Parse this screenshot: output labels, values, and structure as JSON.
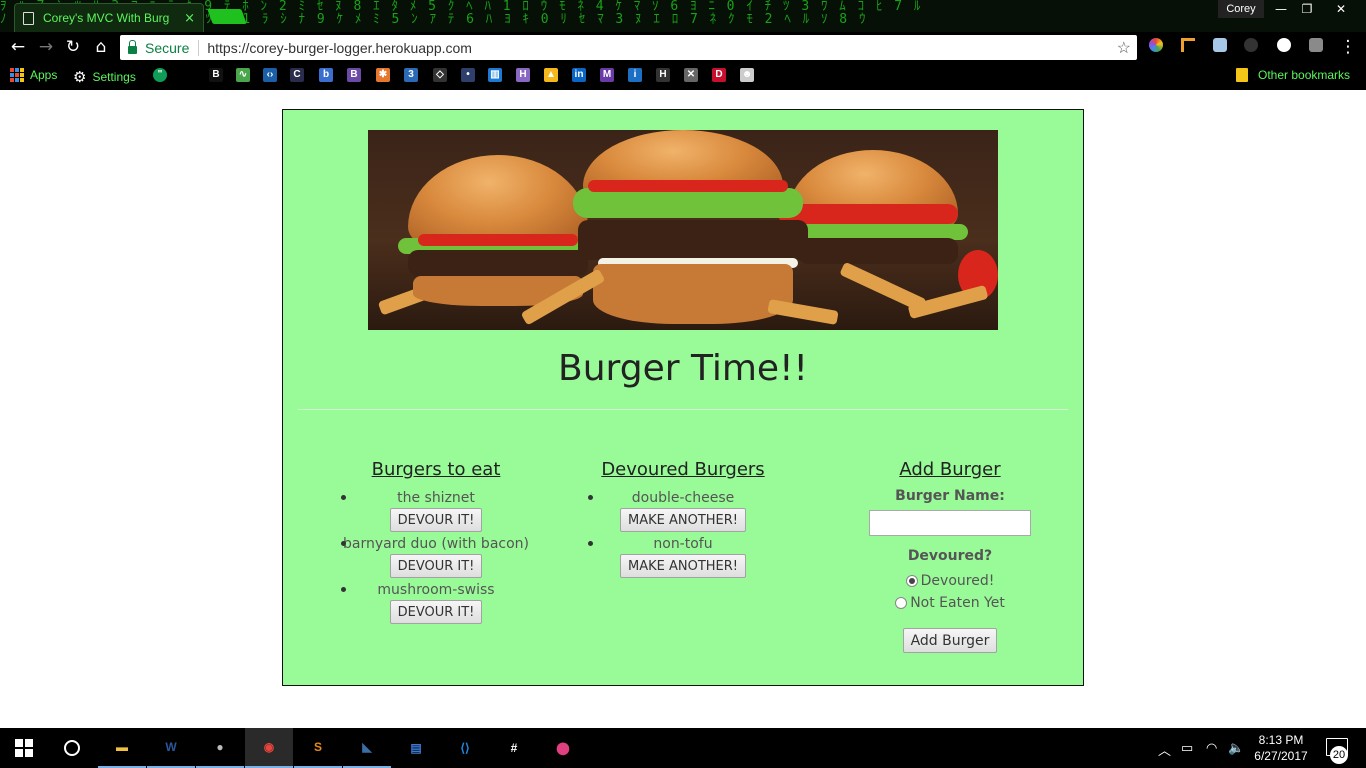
{
  "browser": {
    "tab_title": "Corey's MVC With Burg",
    "tab_close": "×",
    "profile_name": "Corey",
    "window_controls": [
      "—",
      "❐",
      "✕"
    ],
    "nav": {
      "back": "←",
      "forward": "→",
      "reload": "↻",
      "home": "⌂"
    },
    "secure_label": "Secure",
    "url": "https://corey-burger-logger.herokuapp.com",
    "star": "☆",
    "menu": "⋮"
  },
  "bookmarks": {
    "apps_label": "Apps",
    "settings_label": "Settings",
    "other_label": "Other bookmarks",
    "icons": [
      {
        "name": "bookmark-b-icon",
        "glyph": "B",
        "color": "#111111"
      },
      {
        "name": "bookmark-chart-icon",
        "glyph": "∿",
        "color": "#4aa64a"
      },
      {
        "name": "bookmark-code-icon",
        "glyph": "‹›",
        "color": "#1b5fa8"
      },
      {
        "name": "bookmark-c-icon",
        "glyph": "C",
        "color": "#2b2b4b"
      },
      {
        "name": "bookmark-bing-icon",
        "glyph": "b",
        "color": "#3a6fd0"
      },
      {
        "name": "bookmark-bootstrap-icon",
        "glyph": "B",
        "color": "#6a4aa6"
      },
      {
        "name": "bookmark-asterisk-icon",
        "glyph": "✱",
        "color": "#e8772e"
      },
      {
        "name": "bookmark-css3-icon",
        "glyph": "3",
        "color": "#2a6ab6"
      },
      {
        "name": "bookmark-diamond-icon",
        "glyph": "◇",
        "color": "#333333"
      },
      {
        "name": "bookmark-dot-icon",
        "glyph": "•",
        "color": "#2d3f6a"
      },
      {
        "name": "bookmark-trello-icon",
        "glyph": "▥",
        "color": "#1c7ad3"
      },
      {
        "name": "bookmark-h-icon",
        "glyph": "H",
        "color": "#8a67c2"
      },
      {
        "name": "bookmark-firebase-icon",
        "glyph": "▲",
        "color": "#f5b81c"
      },
      {
        "name": "bookmark-linkedin-icon",
        "glyph": "in",
        "color": "#0a66c2"
      },
      {
        "name": "bookmark-m-icon",
        "glyph": "M",
        "color": "#6a3aa6"
      },
      {
        "name": "bookmark-info-icon",
        "glyph": "i",
        "color": "#1c6fc2"
      },
      {
        "name": "bookmark-h2-icon",
        "glyph": "H",
        "color": "#333333"
      },
      {
        "name": "bookmark-x-icon",
        "glyph": "✕",
        "color": "#666666"
      },
      {
        "name": "bookmark-d-icon",
        "glyph": "D",
        "color": "#c8102e"
      },
      {
        "name": "bookmark-reddit-icon",
        "glyph": "☻",
        "color": "#cccccc"
      }
    ]
  },
  "page": {
    "title": "Burger Time!!",
    "to_eat": {
      "heading": "Burgers to eat",
      "button_label": "DEVOUR IT!",
      "items": [
        "the shiznet",
        "barnyard duo (with bacon)",
        "mushroom-swiss"
      ]
    },
    "devoured": {
      "heading": "Devoured Burgers",
      "button_label": "MAKE ANOTHER!",
      "items": [
        "double-cheese",
        "non-tofu"
      ]
    },
    "add_form": {
      "heading": "Add Burger",
      "name_label": "Burger Name:",
      "name_value": "",
      "devoured_label": "Devoured?",
      "option_devoured": "Devoured!",
      "option_not_eaten": "Not Eaten Yet",
      "selected": "devoured",
      "submit_label": "Add Burger"
    }
  },
  "taskbar": {
    "time": "8:13 PM",
    "date": "6/27/2017",
    "notification_count": "20",
    "apps": [
      {
        "name": "file-explorer-icon",
        "glyph": "▬",
        "color": "#f0c040"
      },
      {
        "name": "word-icon",
        "glyph": "W",
        "color": "#2b579a"
      },
      {
        "name": "github-icon",
        "glyph": "●",
        "color": "#bbbbbb"
      },
      {
        "name": "chrome-icon",
        "glyph": "◉",
        "color": "#e8453c"
      },
      {
        "name": "sublime-icon",
        "glyph": "S",
        "color": "#e88a1a"
      },
      {
        "name": "mysql-workbench-icon",
        "glyph": "◣",
        "color": "#3a6ea5"
      },
      {
        "name": "window-app-icon",
        "glyph": "▤",
        "color": "#3a7bd5"
      },
      {
        "name": "vscode-icon",
        "glyph": "⟨⟩",
        "color": "#1e88e5"
      },
      {
        "name": "slack-icon",
        "glyph": "#",
        "color": "#ffffff"
      },
      {
        "name": "maps-pin-icon",
        "glyph": "⬤",
        "color": "#e04080"
      }
    ]
  },
  "colors": {
    "panel_bg": "#99fb98",
    "matrix_green": "#1fd31f",
    "bookmark_text": "#5cf55c"
  }
}
